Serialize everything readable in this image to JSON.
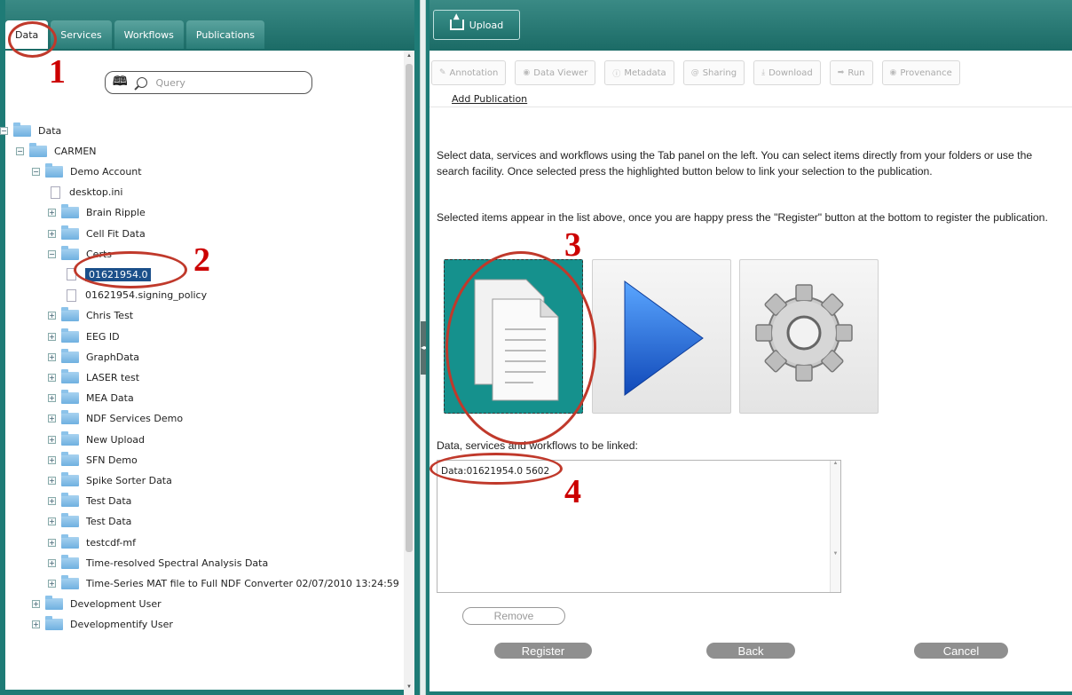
{
  "left_panel": {
    "tabs": [
      {
        "label": "Data",
        "active": true
      },
      {
        "label": "Services",
        "active": false
      },
      {
        "label": "Workflows",
        "active": false
      },
      {
        "label": "Publications",
        "active": false
      }
    ],
    "search": {
      "placeholder": "Query"
    },
    "tree": [
      {
        "label": "Data",
        "type": "folder",
        "level": 0,
        "expander": "−"
      },
      {
        "label": "CARMEN",
        "type": "folder",
        "level": 1,
        "expander": "−"
      },
      {
        "label": "Demo Account",
        "type": "folder",
        "level": 2,
        "expander": "−"
      },
      {
        "label": "desktop.ini",
        "type": "file",
        "level": 3
      },
      {
        "label": "Brain Ripple",
        "type": "folder",
        "level": 3,
        "expander": "+"
      },
      {
        "label": "Cell Fit Data",
        "type": "folder",
        "level": 3,
        "expander": "+"
      },
      {
        "label": "Certs",
        "type": "folder",
        "level": 3,
        "expander": "−"
      },
      {
        "label": "01621954.0",
        "type": "file",
        "level": 4,
        "selected": true
      },
      {
        "label": "01621954.signing_policy",
        "type": "file",
        "level": 4
      },
      {
        "label": "Chris Test",
        "type": "folder",
        "level": 3,
        "expander": "+"
      },
      {
        "label": "EEG ID",
        "type": "folder",
        "level": 3,
        "expander": "+"
      },
      {
        "label": "GraphData",
        "type": "folder",
        "level": 3,
        "expander": "+"
      },
      {
        "label": "LASER test",
        "type": "folder",
        "level": 3,
        "expander": "+"
      },
      {
        "label": "MEA Data",
        "type": "folder",
        "level": 3,
        "expander": "+"
      },
      {
        "label": "NDF Services Demo",
        "type": "folder",
        "level": 3,
        "expander": "+"
      },
      {
        "label": "New Upload",
        "type": "folder",
        "level": 3,
        "expander": "+"
      },
      {
        "label": "SFN Demo",
        "type": "folder",
        "level": 3,
        "expander": "+"
      },
      {
        "label": "Spike Sorter Data",
        "type": "folder",
        "level": 3,
        "expander": "+"
      },
      {
        "label": "Test Data",
        "type": "folder",
        "level": 3,
        "expander": "+"
      },
      {
        "label": "Test Data",
        "type": "folder",
        "level": 3,
        "expander": "+"
      },
      {
        "label": "testcdf-mf",
        "type": "folder",
        "level": 3,
        "expander": "+"
      },
      {
        "label": "Time-resolved Spectral Analysis Data",
        "type": "folder",
        "level": 3,
        "expander": "+"
      },
      {
        "label": "Time-Series MAT file to Full NDF Converter 02/07/2010 13:24:59",
        "type": "folder",
        "level": 3,
        "expander": "+"
      },
      {
        "label": "Development User",
        "type": "folder",
        "level": 2,
        "expander": "+"
      },
      {
        "label": "Developmentify User",
        "type": "folder",
        "level": 2,
        "expander": "+"
      }
    ]
  },
  "right_panel": {
    "upload_label": "Upload",
    "toolbar": [
      {
        "label": "Annotation",
        "icon": "pencil-icon"
      },
      {
        "label": "Data Viewer",
        "icon": "eye-icon"
      },
      {
        "label": "Metadata",
        "icon": "info-icon"
      },
      {
        "label": "Sharing",
        "icon": "at-icon"
      },
      {
        "label": "Download",
        "icon": "download-icon"
      },
      {
        "label": "Run",
        "icon": "arrow-right-icon"
      },
      {
        "label": "Provenance",
        "icon": "eye-icon"
      }
    ],
    "add_publication": "Add Publication",
    "instructions_1": "Select data, services and workflows using the Tab panel on the left. You can select items directly from your folders or use the search facility. Once selected press the highlighted button below to link your selection to the publication.",
    "instructions_2": "Selected items appear in the list above, once you are happy press the \"Register\" button at the bottom to register the publication.",
    "type_tiles": [
      {
        "name": "data-documents-icon",
        "selected": true
      },
      {
        "name": "service-play-icon",
        "selected": false
      },
      {
        "name": "workflow-gear-icon",
        "selected": false
      }
    ],
    "linked_label": "Data, services and workflows to be linked:",
    "linked_items": [
      "Data:01621954.0 5602"
    ],
    "remove_label": "Remove",
    "register_label": "Register",
    "back_label": "Back",
    "cancel_label": "Cancel"
  },
  "annotations": {
    "n1": "1",
    "n2": "2",
    "n3": "3",
    "n4": "4",
    "color": "#cc0000"
  },
  "colors": {
    "teal": "#1e7b76",
    "selected_tile": "#15918d"
  }
}
